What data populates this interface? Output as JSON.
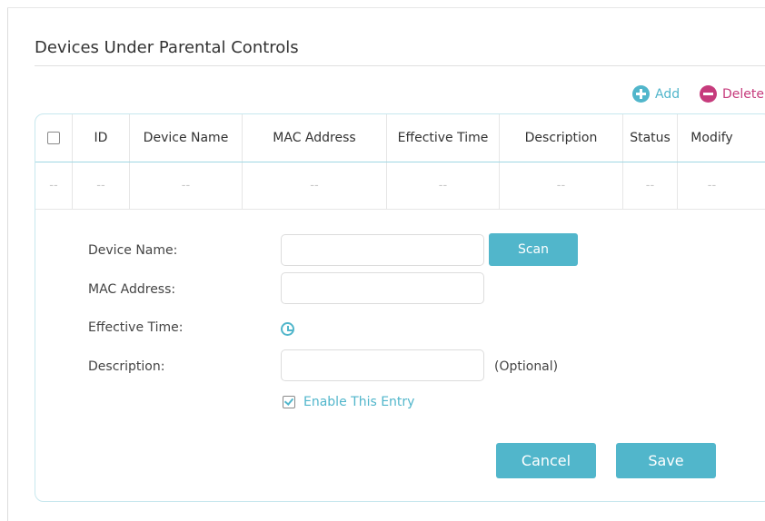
{
  "section": {
    "title": "Devices Under Parental Controls"
  },
  "toolbar": {
    "add_label": "Add",
    "delete_label": "Delete"
  },
  "table": {
    "columns": [
      "ID",
      "Device Name",
      "MAC Address",
      "Effective Time",
      "Description",
      "Status",
      "Modify"
    ],
    "empty_row": [
      "--",
      "--",
      "--",
      "--",
      "--",
      "--",
      "--",
      "--"
    ]
  },
  "form": {
    "device_name_label": "Device Name:",
    "device_name_value": "",
    "scan_label": "Scan",
    "mac_label": "MAC Address:",
    "mac_value": "",
    "effective_time_label": "Effective Time:",
    "description_label": "Description:",
    "description_value": "",
    "optional_label": "(Optional)",
    "enable_label": "Enable This Entry",
    "enable_checked": true,
    "cancel_label": "Cancel",
    "save_label": "Save"
  },
  "icons": {
    "add": "plus-circle-icon",
    "delete": "minus-circle-icon",
    "clock": "clock-icon"
  },
  "colors": {
    "accent": "#51b6cb",
    "delete": "#c63b7c",
    "border": "#c7e7ee"
  }
}
